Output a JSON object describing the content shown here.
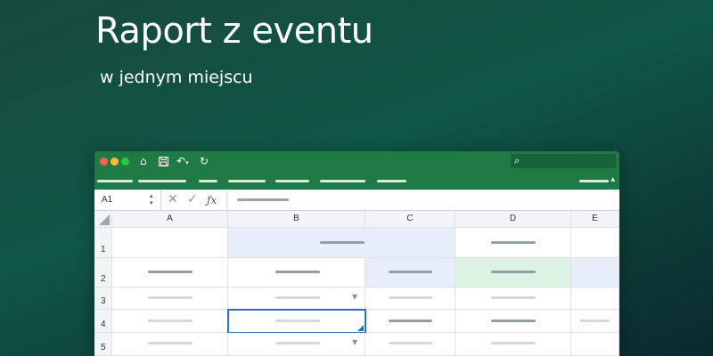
{
  "hero": {
    "title": "Raport z eventu",
    "subtitle": "w jednym miejscu"
  },
  "window": {
    "toolbar_icons": [
      "home-icon",
      "save-icon",
      "undo-icon",
      "redo-icon"
    ],
    "search_icon": "search-icon"
  },
  "formula_bar": {
    "cell_ref": "A1",
    "cancel_glyph": "✕",
    "confirm_glyph": "✓",
    "fx_label": "ƒx"
  },
  "columns": [
    "A",
    "B",
    "C",
    "D",
    "E"
  ],
  "rows": [
    "1",
    "2",
    "3",
    "4",
    "5"
  ],
  "colors": {
    "titlebar": "#1f7a45",
    "header_fill_blue": "#e7eefa",
    "header_fill_green": "#dcf3e3",
    "selection": "#2b6fc2"
  }
}
